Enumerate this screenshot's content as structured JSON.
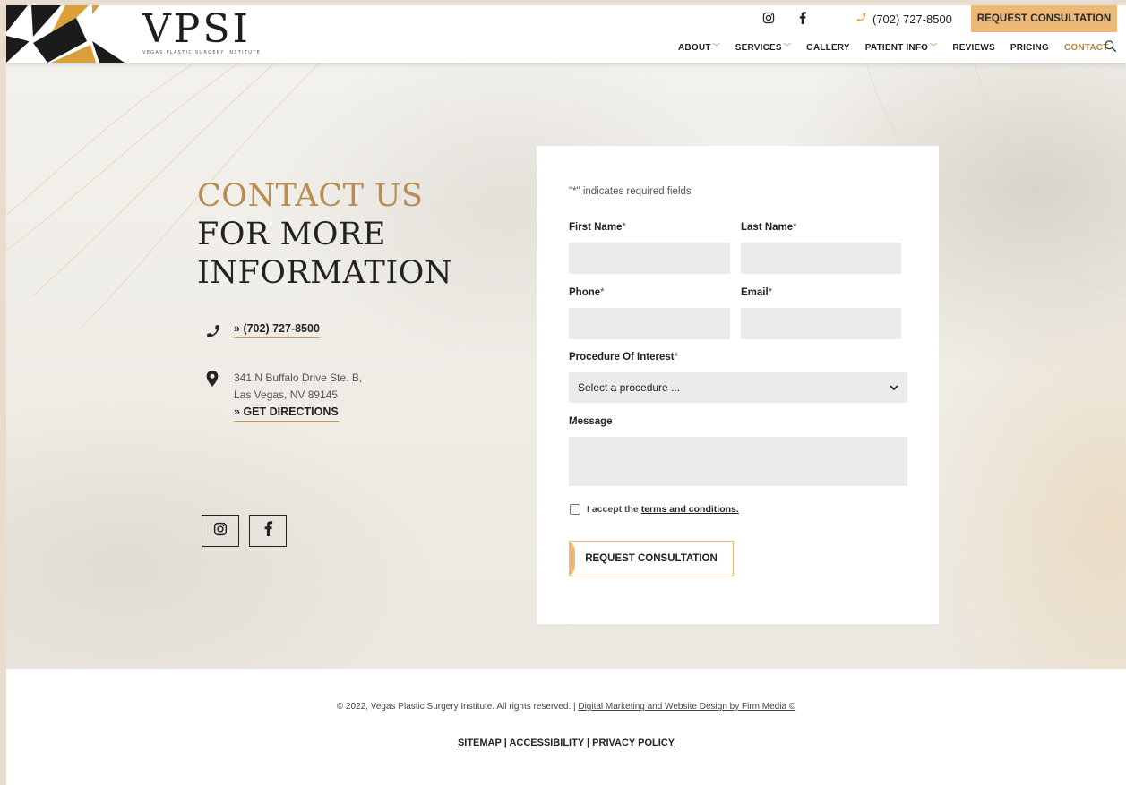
{
  "brand": {
    "name": "VPSI",
    "tagline": "VEGAS PLASTIC SURGERY INSTITUTE",
    "gold": "#edb977",
    "accent_text": "#b98c52"
  },
  "header": {
    "phone": "(702) 727-8500",
    "cta": "REQUEST CONSULTATION",
    "social": [
      "instagram-icon",
      "facebook-icon"
    ],
    "nav": [
      {
        "label": "ABOUT",
        "has_dropdown": true
      },
      {
        "label": "SERVICES",
        "has_dropdown": true
      },
      {
        "label": "GALLERY",
        "has_dropdown": false
      },
      {
        "label": "PATIENT INFO",
        "has_dropdown": true
      },
      {
        "label": "REVIEWS",
        "has_dropdown": false
      },
      {
        "label": "PRICING",
        "has_dropdown": false
      },
      {
        "label": "CONTACT",
        "has_dropdown": false,
        "active": true
      }
    ]
  },
  "hero": {
    "headline_line1": "CONTACT US",
    "headline_line2": "FOR MORE",
    "headline_line3": "INFORMATION",
    "phone_prefix": "»",
    "phone": "(702) 727-8500",
    "address_line1": "341 N Buffalo Drive Ste. B,",
    "address_line2": "Las Vegas, NV 89145",
    "directions": "GET DIRECTIONS"
  },
  "form": {
    "required_note": "\"*\" indicates required fields",
    "first_name_label": "First Name",
    "last_name_label": "Last Name",
    "phone_label": "Phone",
    "email_label": "Email",
    "procedure_label": "Procedure Of Interest",
    "procedure_selected": "Select a procedure ...",
    "message_label": "Message",
    "required_mark": "*",
    "accept_text": "I accept the",
    "terms_link": "terms and conditions.",
    "submit": "REQUEST CONSULTATION"
  },
  "footer": {
    "copyright": "© 2022, Vegas Plastic Surgery Institute. All rights reserved. |",
    "credit_link": "Digital Marketing and Website Design by Firm Media ©",
    "links": [
      "SITEMAP",
      "ACCESSIBILITY",
      "PRIVACY POLICY"
    ],
    "separator": " | "
  }
}
